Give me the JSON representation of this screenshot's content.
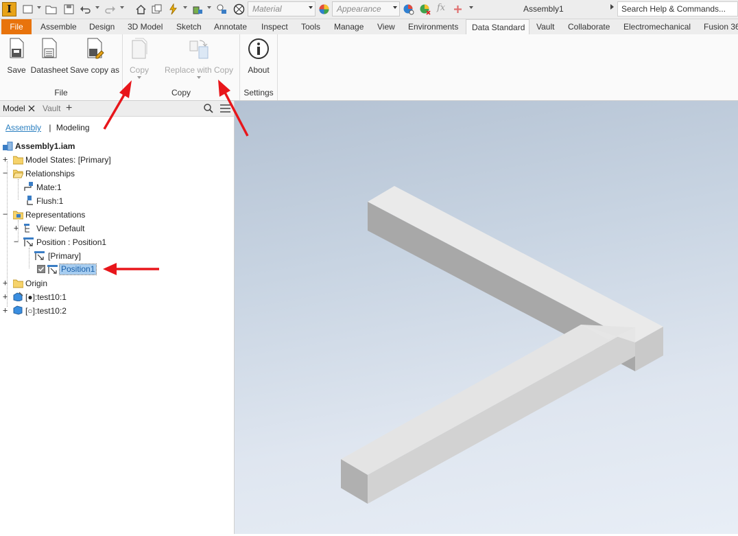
{
  "app": {
    "logo_letter": "I",
    "document_title": "Assembly1"
  },
  "quick_access": {
    "material_placeholder": "Material",
    "appearance_placeholder": "Appearance",
    "fx_label": "fx",
    "search_text": "Search Help & Commands..."
  },
  "ribbon_tabs": [
    "File",
    "Assemble",
    "Design",
    "3D Model",
    "Sketch",
    "Annotate",
    "Inspect",
    "Tools",
    "Manage",
    "View",
    "Environments",
    "Data Standard",
    "Vault",
    "Collaborate",
    "Electromechanical",
    "Fusion 36"
  ],
  "active_tab": "Data Standard",
  "ribbon": {
    "file_panel": {
      "title": "File",
      "save": "Save",
      "datasheet": "Datasheet",
      "save_copy_as": "Save copy as"
    },
    "copy_panel": {
      "title": "Copy",
      "copy": "Copy",
      "replace_with_copy": "Replace with Copy"
    },
    "settings_panel": {
      "title": "Settings",
      "about": "About"
    }
  },
  "browser": {
    "tabs": {
      "model": "Model",
      "vault": "Vault",
      "add": "+"
    },
    "views": {
      "assembly": "Assembly",
      "separator": "|",
      "modeling": "Modeling"
    },
    "tree": {
      "root": "Assembly1.iam",
      "model_states": "Model States: [Primary]",
      "relationships": "Relationships",
      "mate": "Mate:1",
      "flush": "Flush:1",
      "representations": "Representations",
      "view": "View: Default",
      "position": "Position : Position1",
      "position_primary": "[Primary]",
      "position1": "Position1",
      "origin": "Origin",
      "part1": "[●]:test10:1",
      "part2": "[○]:test10:2"
    }
  },
  "colors": {
    "file_tab": "#e8730c",
    "annotation_arrow": "#e8161b",
    "selection": "#a7cdf0"
  }
}
